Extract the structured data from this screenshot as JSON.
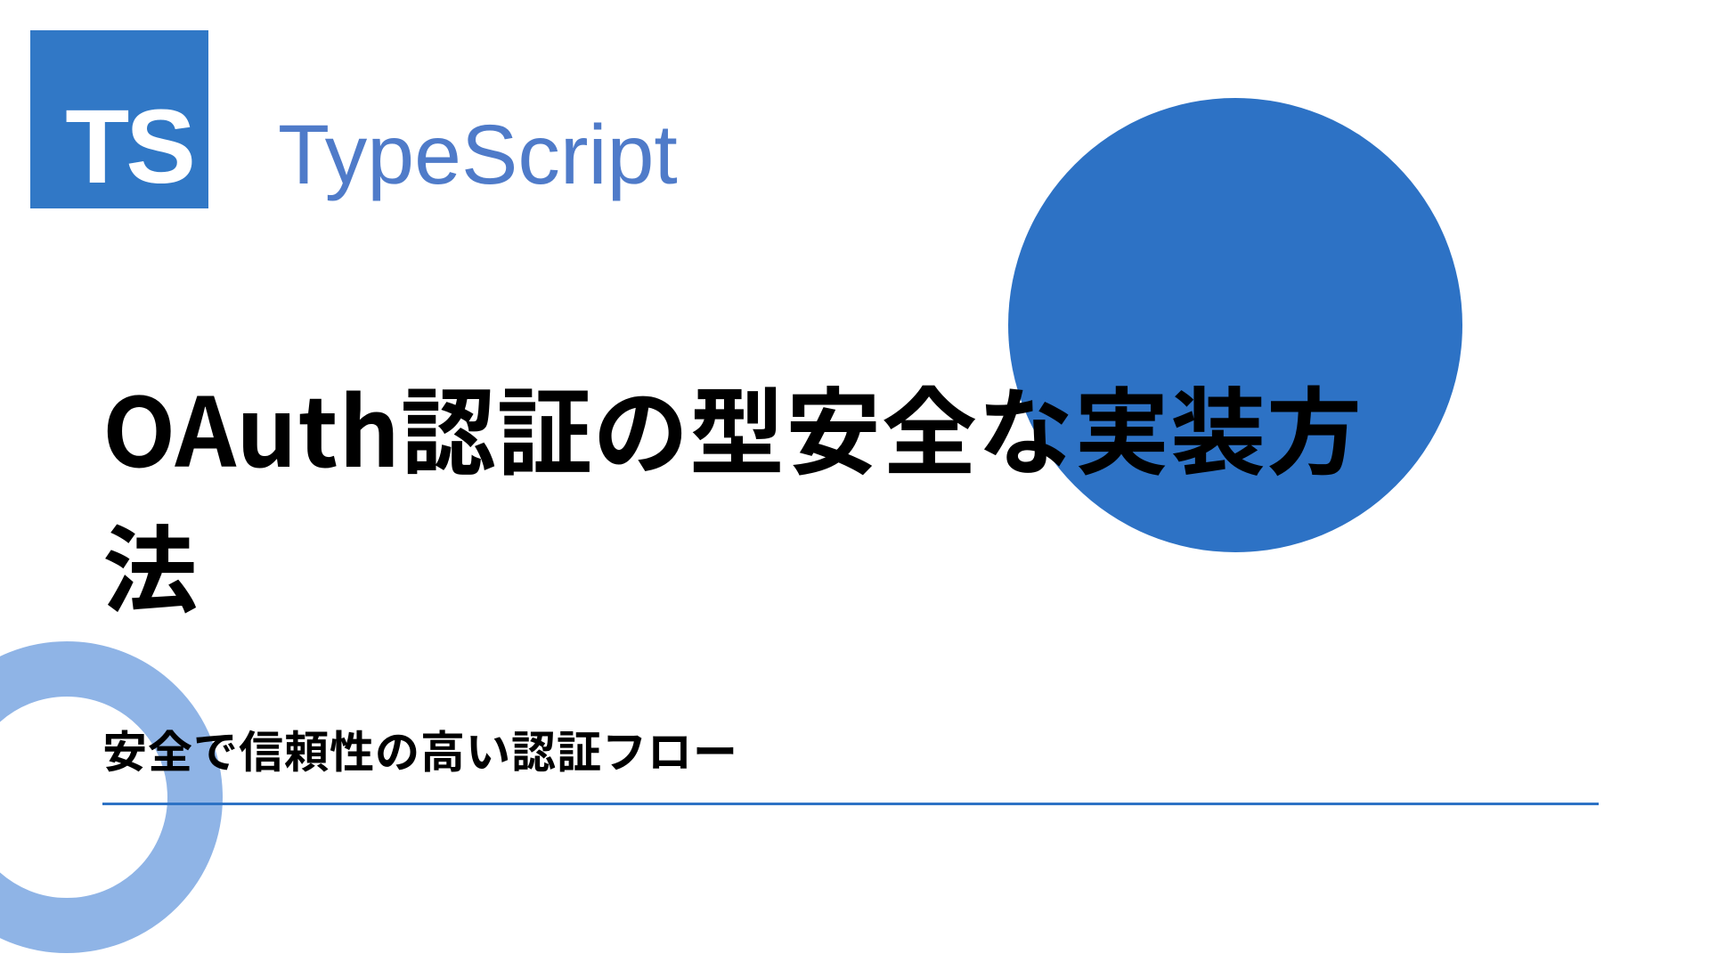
{
  "logo": {
    "text": "TS"
  },
  "brand": "TypeScript",
  "title": "OAuth認証の型安全な実装方法",
  "subtitle": "安全で信頼性の高い認証フロー",
  "colors": {
    "primary": "#3178c6",
    "circle": "#2d72c5",
    "ring": "#8fb4e6",
    "brandText": "#4f7bc9"
  }
}
